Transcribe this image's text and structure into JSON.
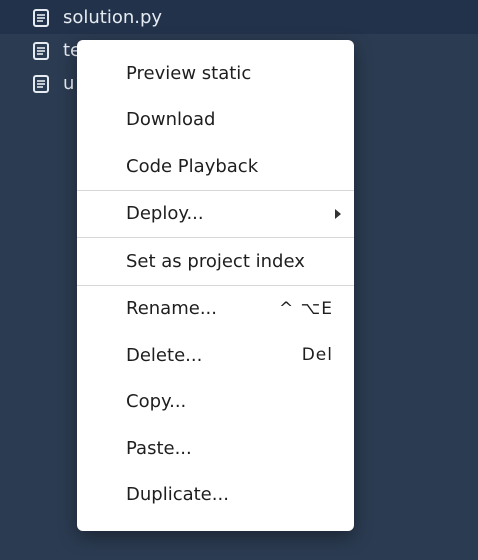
{
  "file_tree": {
    "files": [
      {
        "name": "",
        "icon": "file-icon"
      },
      {
        "name": "solution.py",
        "icon": "file-icon",
        "selected": true
      },
      {
        "name": "te",
        "icon": "file-icon"
      },
      {
        "name": "u",
        "icon": "file-icon"
      }
    ]
  },
  "context_menu": {
    "groups": [
      [
        {
          "label": "Preview static"
        },
        {
          "label": "Download"
        },
        {
          "label": "Code Playback"
        }
      ],
      [
        {
          "label": "Deploy...",
          "submenu": true
        }
      ],
      [
        {
          "label": "Set as project index"
        }
      ],
      [
        {
          "label": "Rename...",
          "shortcut": "^ ⌥E"
        },
        {
          "label": "Delete...",
          "shortcut": "Del"
        },
        {
          "label": "Copy..."
        },
        {
          "label": "Paste..."
        },
        {
          "label": "Duplicate..."
        }
      ]
    ]
  },
  "colors": {
    "background": "#2b3b51",
    "selected_row": "#22324a",
    "menu_background": "#ffffff",
    "menu_text": "#1e1e1e"
  }
}
